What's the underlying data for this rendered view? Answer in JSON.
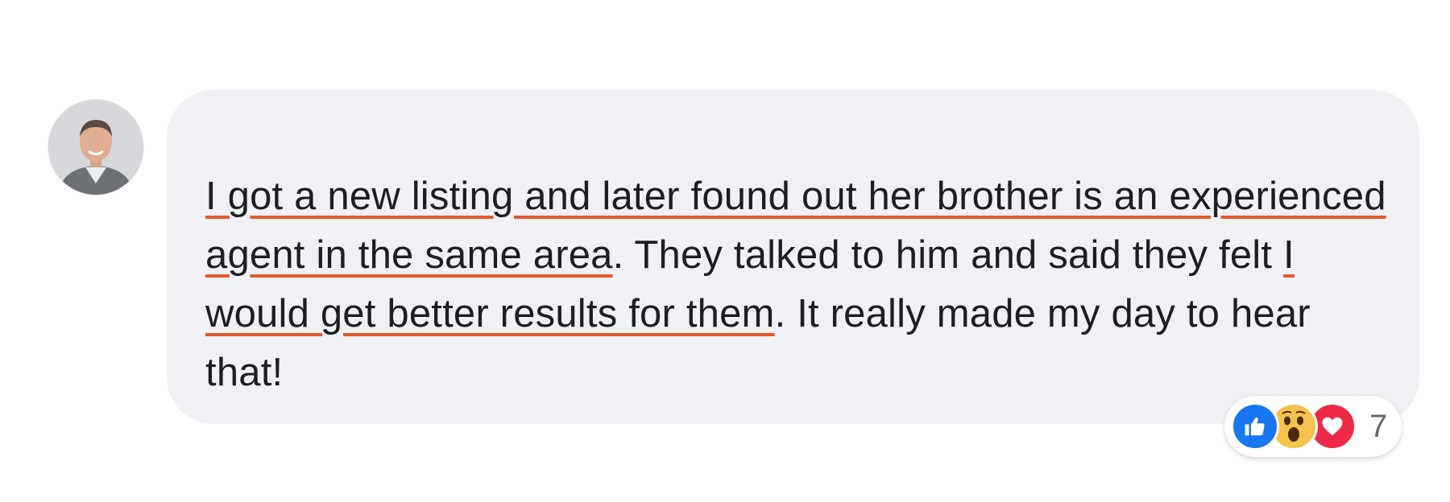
{
  "comment": {
    "segments": [
      {
        "text": "I got a new listing and later found out her brother is an experienced agent in the same area",
        "highlight": true
      },
      {
        "text": ". They talked to him and said they felt ",
        "highlight": false
      },
      {
        "text": "I would get better results for them",
        "highlight": true
      },
      {
        "text": ". It really made my day to hear that!",
        "highlight": false
      }
    ]
  },
  "reactions": {
    "icons": [
      "like-icon",
      "wow-icon",
      "love-icon"
    ],
    "count": "7"
  },
  "colors": {
    "bubble": "#f0f1f4",
    "underline": "#e4582b",
    "like": "#1877f2",
    "love": "#f0284a",
    "wow": "#f7c24a"
  }
}
